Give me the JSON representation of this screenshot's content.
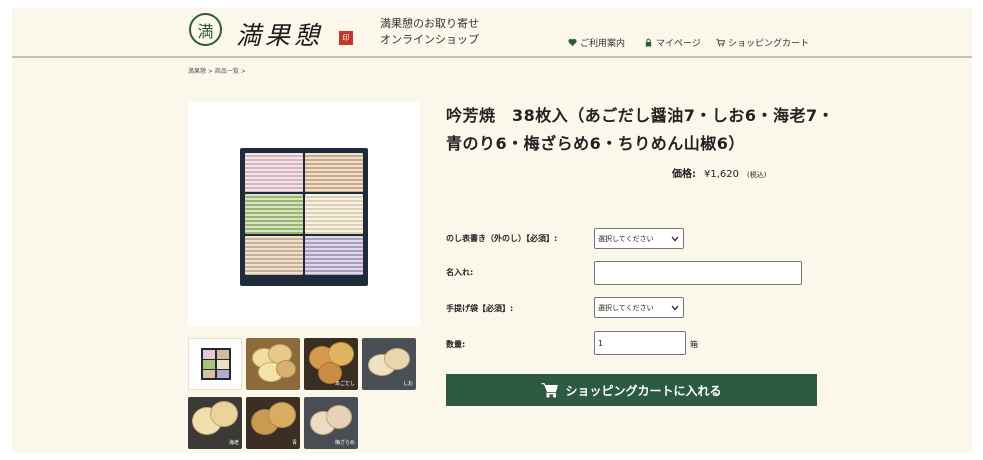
{
  "header": {
    "logo_mark": "満",
    "logo_text": "満果憩",
    "logo_seal": "印",
    "tagline_line1": "満果憩のお取り寄せ",
    "tagline_line2": "オンラインショップ",
    "nav": [
      {
        "label": "ご利用案内",
        "icon": "heart-icon"
      },
      {
        "label": "マイページ",
        "icon": "lock-icon"
      },
      {
        "label": "ショッピングカート",
        "icon": "cart-icon"
      }
    ]
  },
  "breadcrumb": "満果憩 > 商品一覧 >",
  "product": {
    "title": "吟芳焼　38枚入（あごだし醤油7・しお6・海老7・青のり6・梅ざらめ6・ちりめん山椒6）",
    "price_label": "価格:",
    "price": "¥1,620",
    "price_tax": "(税込)"
  },
  "form": {
    "noshi_label": "のし表書き（外のし）【必須】:",
    "noshi_value": "選択してください",
    "name_label": "名入れ:",
    "name_value": "",
    "bag_label": "手提げ袋【必須】:",
    "bag_value": "選択してください",
    "qty_label": "数量:",
    "qty_value": "1",
    "qty_unit": "箱"
  },
  "cart_button": {
    "label": "ショッピングカートに入れる",
    "icon": "cart-icon"
  },
  "thumbnails": [
    {
      "label": ""
    },
    {
      "label": ""
    },
    {
      "label": "あごだし"
    },
    {
      "label": "しお"
    },
    {
      "label": "海老"
    },
    {
      "label": "青"
    },
    {
      "label": "梅ざらめ"
    }
  ],
  "colors": {
    "page_background": "#fbf7ea",
    "accent_green": "#2d5a42",
    "stack_pink": "#e7c6cf",
    "stack_tan": "#d9b993",
    "stack_green": "#a8c47a",
    "stack_cream": "#efe3c4",
    "stack_lavender": "#b7a9cf"
  }
}
